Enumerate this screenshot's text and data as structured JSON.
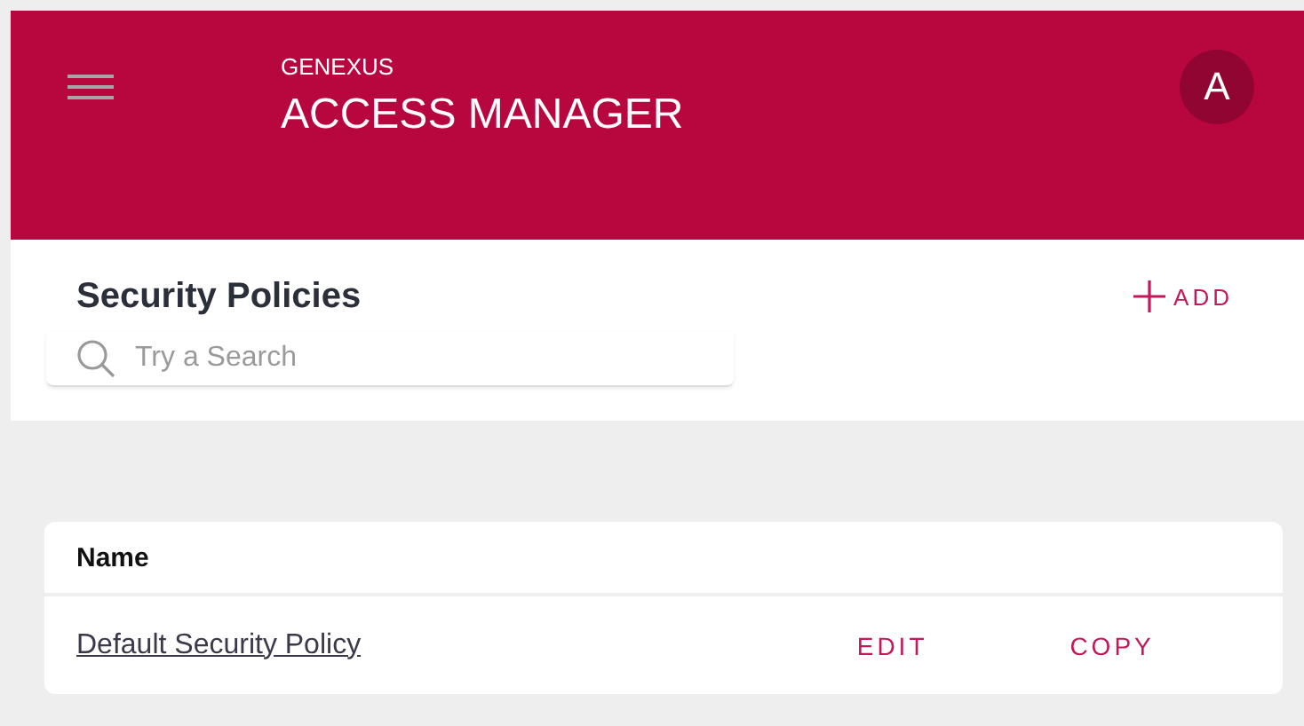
{
  "header": {
    "brand": "GENEXUS",
    "title": "ACCESS MANAGER",
    "avatar": "A"
  },
  "panel": {
    "title": "Security Policies",
    "search": {
      "placeholder": "Try a Search"
    },
    "add_button": "ADD"
  },
  "table": {
    "columns": [
      "Name"
    ],
    "rows": [
      {
        "name": "Default Security Policy",
        "actions": [
          "EDIT",
          "COPY"
        ]
      }
    ]
  }
}
